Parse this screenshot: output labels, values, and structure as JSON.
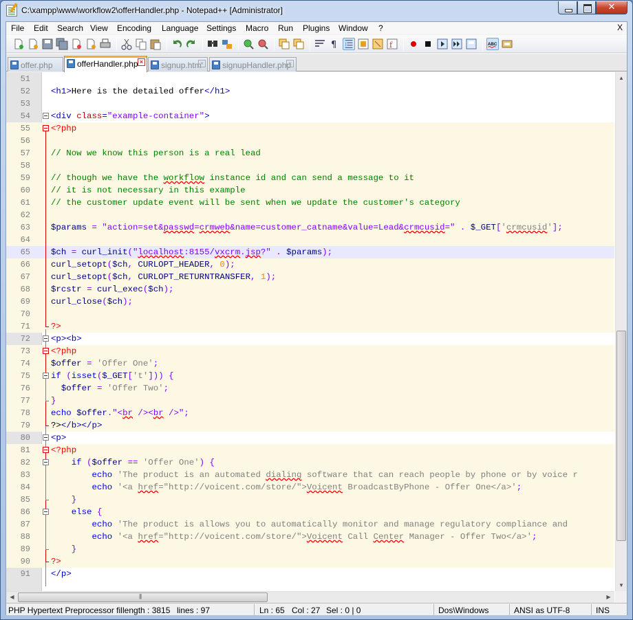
{
  "window": {
    "title": "C:\\xampp\\www\\workflow2\\offerHandler.php - Notepad++ [Administrator]"
  },
  "menu": [
    "File",
    "Edit",
    "Search",
    "View",
    "Encoding",
    "Language",
    "Settings",
    "Macro",
    "Run",
    "Plugins",
    "Window",
    "?"
  ],
  "menu_close": "X",
  "toolbar_icons": [
    "new-file-icon",
    "open-file-icon",
    "save-icon",
    "save-all-icon",
    "close-icon",
    "close-all-icon",
    "print-icon",
    "cut-icon",
    "copy-icon",
    "paste-icon",
    "undo-icon",
    "redo-icon",
    "find-icon",
    "replace-icon",
    "zoom-in-icon",
    "zoom-out-icon",
    "sync-vertical-icon",
    "sync-horizontal-icon",
    "word-wrap-icon",
    "show-all-chars-icon",
    "indent-guide-icon",
    "user-lang-icon",
    "doc-map-icon",
    "function-list-icon",
    "record-macro-icon",
    "stop-macro-icon",
    "play-macro-icon",
    "run-macro-multiple-icon",
    "save-macro-icon",
    "spell-check-icon",
    "plugin-icon"
  ],
  "tabs": [
    {
      "label": "offer.php",
      "active": false
    },
    {
      "label": "offerHandler.php",
      "active": true
    },
    {
      "label": "signup.htm",
      "active": false
    },
    {
      "label": "signupHandler.php",
      "active": false
    }
  ],
  "editor": {
    "current_line": 65,
    "lines": [
      {
        "n": "51",
        "text": ""
      },
      {
        "n": "52",
        "text": "<h1>Here is the detailed offer</h1>"
      },
      {
        "n": "53",
        "text": ""
      },
      {
        "n": "54",
        "text": "<div class=\"example-container\">"
      },
      {
        "n": "55",
        "text": "<?php"
      },
      {
        "n": "56",
        "text": ""
      },
      {
        "n": "57",
        "text": "// Now we know this person is a real lead"
      },
      {
        "n": "58",
        "text": ""
      },
      {
        "n": "59",
        "text": "// though we have the workflow instance id and can send a message to it"
      },
      {
        "n": "60",
        "text": "// it is not necessary in this example"
      },
      {
        "n": "61",
        "text": "// the customer update event will be sent when we update the customer's category"
      },
      {
        "n": "62",
        "text": ""
      },
      {
        "n": "63",
        "text": "$params = \"action=set&passwd=crmweb&name=customer_catname&value=Lead&crmcusid=\" . $_GET['crmcusid'];"
      },
      {
        "n": "64",
        "text": ""
      },
      {
        "n": "65",
        "text": "$ch = curl_init(\"localhost:8155/vxcrm.jsp?\" . $params);"
      },
      {
        "n": "66",
        "text": "curl_setopt($ch, CURLOPT_HEADER, 0);"
      },
      {
        "n": "67",
        "text": "curl_setopt($ch, CURLOPT_RETURNTRANSFER, 1);"
      },
      {
        "n": "68",
        "text": "$rcstr = curl_exec($ch);"
      },
      {
        "n": "69",
        "text": "curl_close($ch);"
      },
      {
        "n": "70",
        "text": ""
      },
      {
        "n": "71",
        "text": "?>"
      },
      {
        "n": "72",
        "text": "<p><b>"
      },
      {
        "n": "73",
        "text": "<?php"
      },
      {
        "n": "74",
        "text": "$offer = 'Offer One';"
      },
      {
        "n": "75",
        "text": "if (isset($_GET['t'])) {"
      },
      {
        "n": "76",
        "text": "  $offer = 'Offer Two';"
      },
      {
        "n": "77",
        "text": "}"
      },
      {
        "n": "78",
        "text": "echo $offer.\"<br /><br />\";"
      },
      {
        "n": "79",
        "text": "?></b></p>"
      },
      {
        "n": "80",
        "text": "<p>"
      },
      {
        "n": "81",
        "text": "<?php"
      },
      {
        "n": "82",
        "text": "    if ($offer == 'Offer One') {"
      },
      {
        "n": "83",
        "text": "        echo 'The product is an automated dialing software that can reach people by phone or by voice r"
      },
      {
        "n": "84",
        "text": "        echo '<a href=\"http://voicent.com/store/\">Voicent BroadcastByPhone - Offer One</a>';"
      },
      {
        "n": "85",
        "text": "    }"
      },
      {
        "n": "86",
        "text": "    else {"
      },
      {
        "n": "87",
        "text": "        echo 'The product is allows you to automatically monitor and manage regulatory compliance and"
      },
      {
        "n": "88",
        "text": "        echo '<a href=\"http://voicent.com/store/\">Voicent Call Center Manager - Offer Two</a>';"
      },
      {
        "n": "89",
        "text": "    }"
      },
      {
        "n": "90",
        "text": "?>"
      },
      {
        "n": "91",
        "text": "</p>"
      }
    ]
  },
  "status": {
    "lang": "PHP Hypertext Preprocessor fil",
    "length": "length : 3815",
    "lines": "lines : 97",
    "ln": "Ln : 65",
    "col": "Col : 27",
    "sel": "Sel : 0 | 0",
    "eol": "Dos\\Windows",
    "enc": "ANSI as UTF-8",
    "mode": "INS"
  },
  "colors": {
    "tag": "#0000c0",
    "attr": "#c00000",
    "string": "#8000ff",
    "php_delim": "#ff0000",
    "comment": "#008000",
    "variable": "#000080",
    "single_quoted": "#808080",
    "number": "#ff8000",
    "keyword": "#0000ff",
    "php_bg": "#fdf8e3",
    "current_line_bg": "#e8e8ff"
  }
}
